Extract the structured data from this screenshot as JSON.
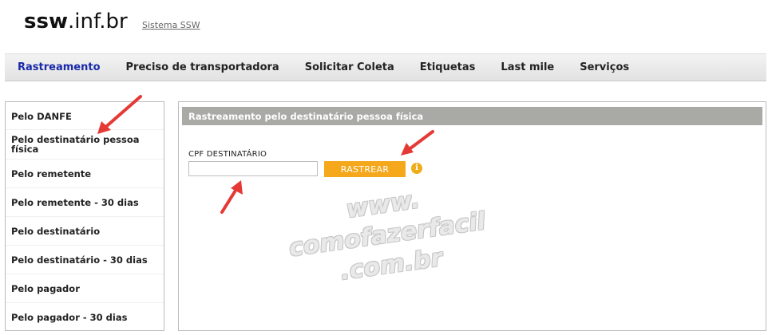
{
  "header": {
    "logo_bold": "ssw",
    "logo_rest": ".inf.br",
    "system_link": "Sistema SSW"
  },
  "nav": {
    "items": [
      {
        "label": "Rastreamento",
        "active": true
      },
      {
        "label": "Preciso de transportadora"
      },
      {
        "label": "Solicitar Coleta"
      },
      {
        "label": "Etiquetas"
      },
      {
        "label": "Last mile"
      },
      {
        "label": "Serviços"
      }
    ]
  },
  "sidebar": {
    "items": [
      {
        "label": "Pelo DANFE"
      },
      {
        "label": "Pelo destinatário pessoa física"
      },
      {
        "label": "Pelo remetente"
      },
      {
        "label": "Pelo remetente - 30 dias"
      },
      {
        "label": "Pelo destinatário"
      },
      {
        "label": "Pelo destinatário - 30 dias"
      },
      {
        "label": "Pelo pagador"
      },
      {
        "label": "Pelo pagador - 30 dias"
      }
    ]
  },
  "panel": {
    "title": "Rastreamento pelo destinatário pessoa física",
    "field_label": "CPF DESTINATÁRIO",
    "field_value": "",
    "button_label": "RASTREAR",
    "info_icon": "info-icon"
  },
  "watermark": {
    "line1": "www.",
    "line2": "comofazerfacil",
    "line3": ".com.br"
  },
  "colors": {
    "accent_button": "#f5a81c",
    "active_nav": "#1a2aa8",
    "annotation_arrow": "#e53935",
    "panel_header": "#a9a9a5"
  }
}
